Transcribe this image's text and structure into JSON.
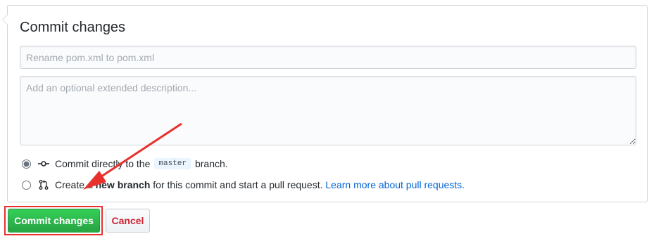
{
  "commit_form": {
    "title": "Commit changes",
    "summary_placeholder": "Rename pom.xml to pom.xml",
    "description_placeholder": "Add an optional extended description...",
    "options": [
      {
        "selected": true,
        "icon": "git-commit-icon",
        "text_before": "Commit directly to the",
        "branch": "master",
        "text_after": "branch."
      },
      {
        "selected": false,
        "icon": "git-pull-request-icon",
        "text_before": "Create a",
        "bold_text": "new branch",
        "text_after": "for this commit and start a pull request.",
        "link_text": "Learn more about pull requests."
      }
    ]
  },
  "buttons": {
    "commit_label": "Commit changes",
    "cancel_label": "Cancel"
  },
  "annotation": {
    "highlight_color": "#e8302d",
    "arrow_color": "#e8302d"
  }
}
